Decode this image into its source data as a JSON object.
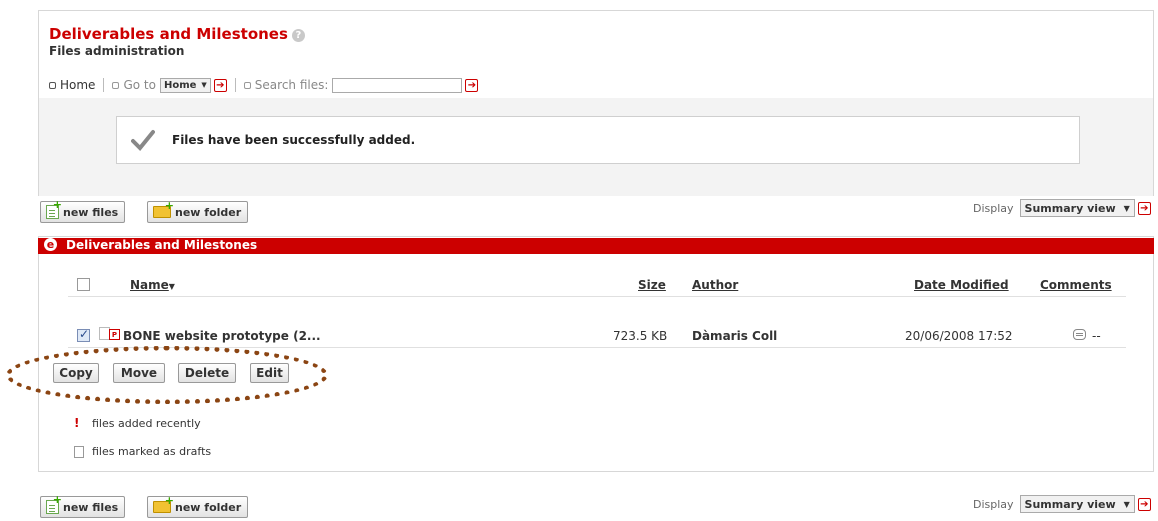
{
  "header": {
    "title": "Deliverables and Milestones",
    "subtitle": "Files administration"
  },
  "nav": {
    "home_label": "Home",
    "goto_label": "Go to",
    "goto_value": "Home",
    "search_label": "Search files:",
    "search_value": ""
  },
  "message": {
    "text": "Files have been successfully added."
  },
  "toolbar": {
    "new_files_label": "new files",
    "new_folder_label": "new folder",
    "display_label": "Display",
    "display_value": "Summary view"
  },
  "section": {
    "logo": "e",
    "title": "Deliverables and Milestones"
  },
  "table": {
    "columns": {
      "name": "Name",
      "size": "Size",
      "author": "Author",
      "date_modified": "Date Modified",
      "comments": "Comments"
    },
    "rows": [
      {
        "checked": true,
        "name": "BONE website prototype (2...",
        "size": "723.5 KB",
        "author": "Dàmaris Coll",
        "date_modified": "20/06/2008 17:52",
        "comments": "--"
      }
    ]
  },
  "actions": {
    "copy": "Copy",
    "move": "Move",
    "delete": "Delete",
    "edit": "Edit"
  },
  "legend": {
    "recent": "files added recently",
    "drafts": "files marked as drafts"
  },
  "colors": {
    "accent": "#cc0000",
    "annotation": "#8b4513"
  }
}
